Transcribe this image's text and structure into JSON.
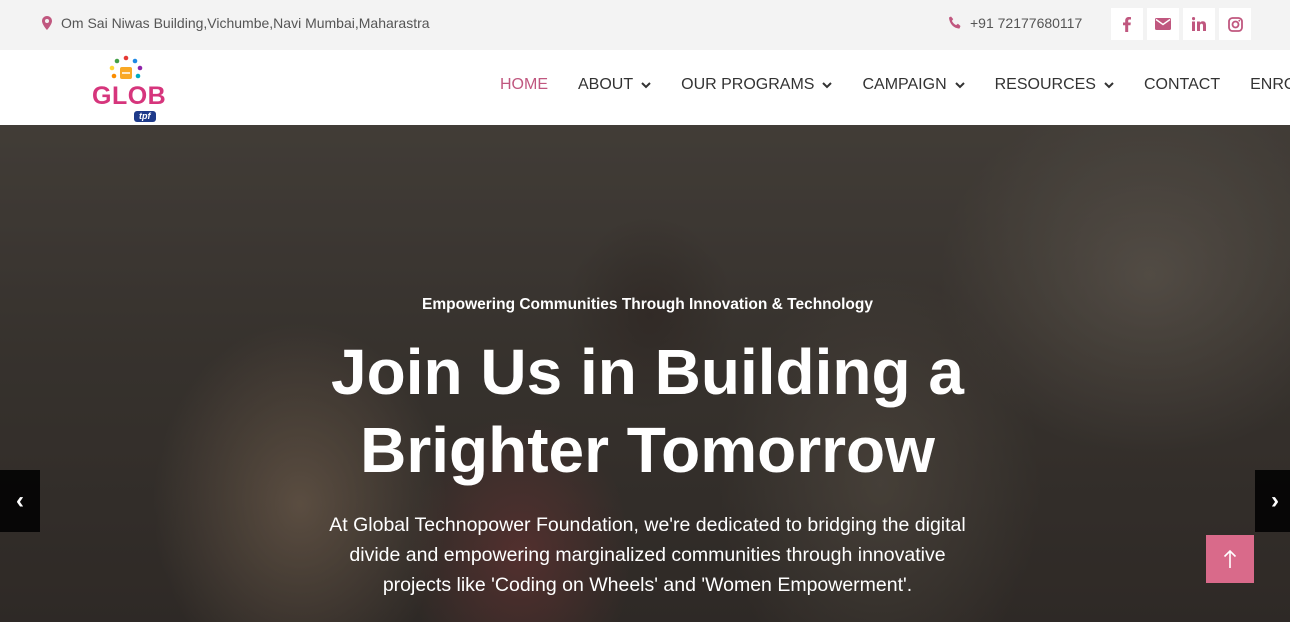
{
  "topbar": {
    "address": "Om Sai Niwas Building,Vichumbe,Navi Mumbai,Maharastra",
    "phone": "+91 72177680117",
    "address_icon": "map-marker-icon",
    "phone_icon": "phone-icon",
    "social": [
      {
        "name": "facebook",
        "icon": "facebook-icon"
      },
      {
        "name": "email",
        "icon": "envelope-icon"
      },
      {
        "name": "linkedin",
        "icon": "linkedin-icon"
      },
      {
        "name": "instagram",
        "icon": "instagram-icon"
      }
    ]
  },
  "logo": {
    "text": "GLOB",
    "tag": "tpf"
  },
  "nav": {
    "items": [
      {
        "label": "HOME",
        "active": true,
        "dropdown": false
      },
      {
        "label": "ABOUT",
        "dropdown": true
      },
      {
        "label": "OUR PROGRAMS",
        "dropdown": true
      },
      {
        "label": "CAMPAIGN",
        "dropdown": true
      },
      {
        "label": "RESOURCES",
        "dropdown": true
      },
      {
        "label": "CONTACT",
        "dropdown": false
      },
      {
        "label": "ENROLL",
        "dropdown": true
      }
    ]
  },
  "hero": {
    "kicker": "Empowering Communities Through Innovation & Technology",
    "headline_line1": "Join Us in Building a",
    "headline_line2": "Brighter Tomorrow",
    "desc_line1": "At Global Technopower Foundation, we're dedicated to bridging the digital",
    "desc_line2": "divide and empowering marginalized communities through innovative",
    "desc_line3": "projects like 'Coding on Wheels' and 'Women Empowerment'.",
    "prev_label": "‹",
    "next_label": "›"
  },
  "colors": {
    "accent": "#c0577f",
    "brand": "#d6357c",
    "totop_bg": "#d96a8a"
  }
}
